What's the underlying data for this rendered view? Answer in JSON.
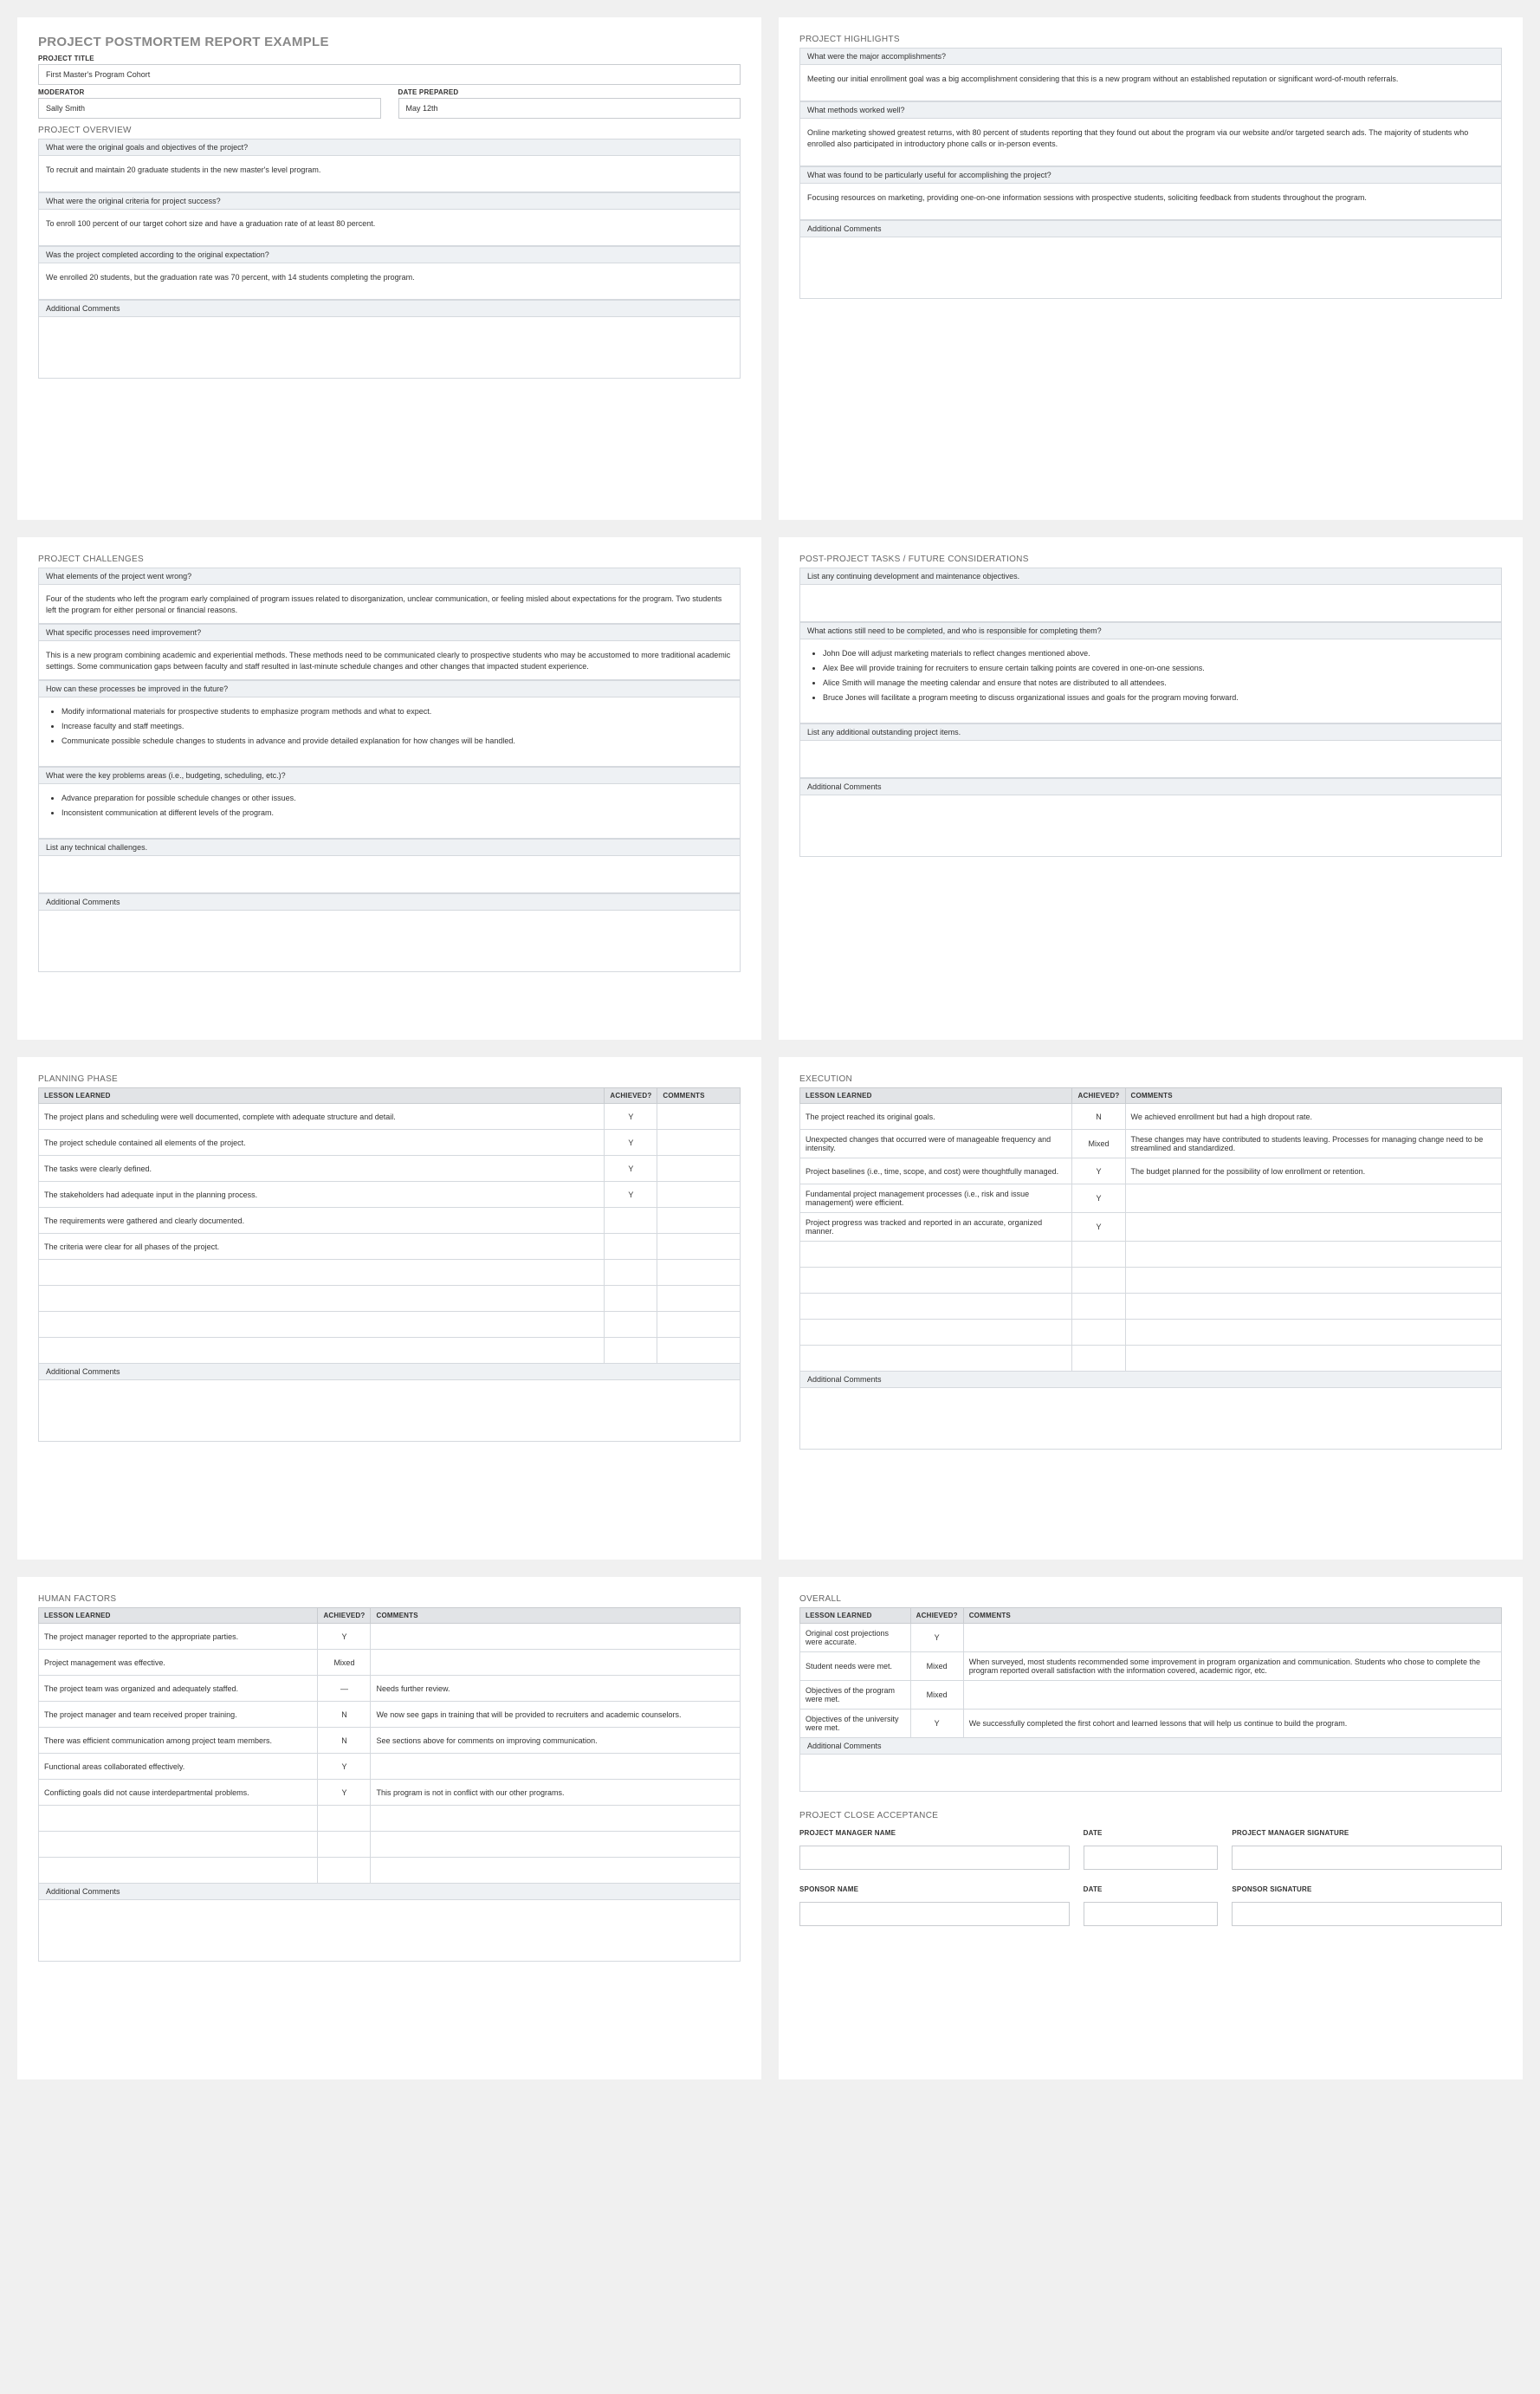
{
  "title": "PROJECT POSTMORTEM REPORT EXAMPLE",
  "meta": {
    "project_title_label": "PROJECT TITLE",
    "project_title": "First Master's Program Cohort",
    "moderator_label": "MODERATOR",
    "moderator": "Sally Smith",
    "date_label": "DATE PREPARED",
    "date": "May 12th"
  },
  "overview": {
    "heading": "PROJECT OVERVIEW",
    "q1": "What were the original goals and objectives of the project?",
    "a1": "To recruit and maintain 20 graduate students in the new master's level program.",
    "q2": "What were the original criteria for project success?",
    "a2": "To enroll 100 percent of our target cohort size and have a graduation rate of at least 80 percent.",
    "q3": "Was the project completed according to the original expectation?",
    "a3": "We enrolled 20 students, but the graduation rate was 70 percent, with 14 students completing the program.",
    "addl": "Additional Comments"
  },
  "highlights": {
    "heading": "PROJECT HIGHLIGHTS",
    "q1": "What were the major accomplishments?",
    "a1": "Meeting our initial enrollment goal was a big accomplishment considering that this is a new program without an established reputation or significant word-of-mouth referrals.",
    "q2": "What methods worked well?",
    "a2": "Online marketing showed greatest returns, with 80 percent of students reporting that they found out about the program via our website and/or targeted search ads. The majority of students who enrolled also participated in introductory phone calls or in-person events.",
    "q3": "What was found to be particularly useful for accomplishing the project?",
    "a3": "Focusing resources on marketing, providing one-on-one information sessions with prospective students, soliciting feedback from students throughout the program.",
    "addl": "Additional Comments"
  },
  "challenges": {
    "heading": "PROJECT CHALLENGES",
    "q1": "What elements of the project went wrong?",
    "a1": "Four of the students who left the program early complained of program issues related to disorganization, unclear communication, or feeling misled  about expectations for the program. Two students left the program for either personal or financial reasons.",
    "q2": "What specific processes need improvement?",
    "a2": "This is a new program combining academic and experiential methods. These methods need to be communicated clearly to prospective students who may be accustomed to more traditional academic settings. Some communication gaps between faculty and staff resulted in last-minute schedule changes and other changes that impacted student experience.",
    "q3": "How can these processes be improved in the future?",
    "a3_items": [
      "Modify informational materials for prospective students to emphasize program methods and what to expect.",
      "Increase faculty and staff meetings.",
      "Communicate possible schedule changes to students in advance and provide detailed explanation for how changes will be handled."
    ],
    "q4": "What were the key problems areas (i.e., budgeting, scheduling, etc.)?",
    "a4_items": [
      "Advance preparation for possible schedule changes or other issues.",
      "Inconsistent communication at different levels of the program."
    ],
    "q5": "List any technical challenges.",
    "addl": "Additional Comments"
  },
  "postproject": {
    "heading": "POST-PROJECT TASKS / FUTURE CONSIDERATIONS",
    "q1": "List any continuing development and maintenance objectives.",
    "q2": "What actions still need to be completed, and who is responsible for completing them?",
    "a2_items": [
      "John Doe will adjust marketing materials to reflect changes mentioned above.",
      "Alex Bee will provide training for recruiters to ensure certain talking points are covered in one-on-one sessions.",
      "Alice Smith will manage the meeting calendar and ensure that notes are distributed to all attendees.",
      "Bruce Jones will facilitate a program meeting to discuss organizational issues and goals for the program moving forward."
    ],
    "q3": "List any additional outstanding project items.",
    "addl": "Additional Comments"
  },
  "table_headers": {
    "lesson": "LESSON LEARNED",
    "achieved": "ACHIEVED?",
    "comments": "COMMENTS"
  },
  "planning": {
    "heading": "PLANNING PHASE",
    "rows": [
      {
        "l": "The project plans and scheduling were well documented, complete with adequate structure and detail.",
        "a": "Y",
        "c": ""
      },
      {
        "l": "The project schedule contained all elements of the project.",
        "a": "Y",
        "c": ""
      },
      {
        "l": "The tasks were clearly defined.",
        "a": "Y",
        "c": ""
      },
      {
        "l": "The stakeholders had adequate input in the planning process.",
        "a": "Y",
        "c": ""
      },
      {
        "l": "The requirements were gathered and clearly documented.",
        "a": "",
        "c": ""
      },
      {
        "l": "The criteria were clear for all phases of the project.",
        "a": "",
        "c": ""
      },
      {
        "l": "",
        "a": "",
        "c": ""
      },
      {
        "l": "",
        "a": "",
        "c": ""
      },
      {
        "l": "",
        "a": "",
        "c": ""
      },
      {
        "l": "",
        "a": "",
        "c": ""
      }
    ],
    "addl": "Additional Comments"
  },
  "execution": {
    "heading": "EXECUTION",
    "rows": [
      {
        "l": "The project reached its original goals.",
        "a": "N",
        "c": "We achieved enrollment but had a high dropout rate."
      },
      {
        "l": "Unexpected changes that occurred were of manageable frequency and intensity.",
        "a": "Mixed",
        "c": "These changes may have contributed to students leaving. Processes for managing change need to be streamlined and standardized."
      },
      {
        "l": "Project baselines (i.e., time, scope, and cost) were thoughtfully managed.",
        "a": "Y",
        "c": "The budget planned for the possibility of low enrollment or retention."
      },
      {
        "l": "Fundamental project management processes (i.e., risk and issue management) were efficient.",
        "a": "Y",
        "c": ""
      },
      {
        "l": "Project progress was tracked and reported in an accurate, organized manner.",
        "a": "Y",
        "c": ""
      },
      {
        "l": "",
        "a": "",
        "c": ""
      },
      {
        "l": "",
        "a": "",
        "c": ""
      },
      {
        "l": "",
        "a": "",
        "c": ""
      },
      {
        "l": "",
        "a": "",
        "c": ""
      },
      {
        "l": "",
        "a": "",
        "c": ""
      }
    ],
    "addl": "Additional Comments"
  },
  "human": {
    "heading": "HUMAN FACTORS",
    "rows": [
      {
        "l": "The project manager reported to the appropriate parties.",
        "a": "Y",
        "c": ""
      },
      {
        "l": "Project management was effective.",
        "a": "Mixed",
        "c": ""
      },
      {
        "l": "The project team was organized and adequately staffed.",
        "a": "—",
        "c": "Needs further review."
      },
      {
        "l": "The project manager and team received proper training.",
        "a": "N",
        "c": "We now see gaps in training that will be provided to recruiters and academic counselors."
      },
      {
        "l": "There was efficient communication among project team members.",
        "a": "N",
        "c": "See sections above for comments on improving communication."
      },
      {
        "l": "Functional areas collaborated effectively.",
        "a": "Y",
        "c": ""
      },
      {
        "l": "Conflicting goals did not cause interdepartmental problems.",
        "a": "Y",
        "c": "This program is not in conflict with our other programs."
      },
      {
        "l": "",
        "a": "",
        "c": ""
      },
      {
        "l": "",
        "a": "",
        "c": ""
      },
      {
        "l": "",
        "a": "",
        "c": ""
      }
    ],
    "addl": "Additional Comments"
  },
  "overall": {
    "heading": "OVERALL",
    "rows": [
      {
        "l": "Original cost projections were accurate.",
        "a": "Y",
        "c": ""
      },
      {
        "l": "Student needs were met.",
        "a": "Mixed",
        "c": "When surveyed, most students recommended some improvement in program organization and communication. Students who chose to complete the program reported overall satisfaction with the information covered, academic rigor, etc."
      },
      {
        "l": "Objectives of the program were met.",
        "a": "Mixed",
        "c": ""
      },
      {
        "l": "Objectives of the university were met.",
        "a": "Y",
        "c": "We successfully completed the first cohort and learned lessons that will help us continue to build the program."
      }
    ],
    "addl": "Additional Comments"
  },
  "close": {
    "heading": "PROJECT CLOSE ACCEPTANCE",
    "pm_name": "PROJECT MANAGER NAME",
    "date": "DATE",
    "pm_sig": "PROJECT MANAGER SIGNATURE",
    "sp_name": "SPONSOR NAME",
    "sp_sig": "SPONSOR SIGNATURE"
  }
}
